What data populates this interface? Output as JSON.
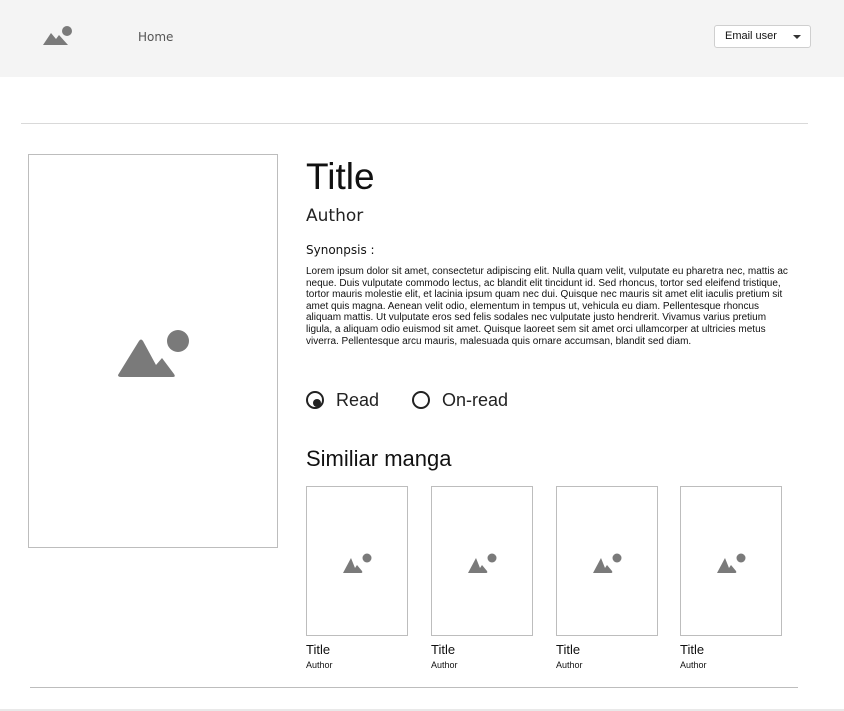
{
  "header": {
    "logo_icon": "image-placeholder-icon",
    "nav_home": "Home",
    "user_menu_label": "Email user"
  },
  "manga": {
    "cover_icon": "image-placeholder-icon",
    "title": "Title",
    "author": "Author",
    "synopsis_label": "Synonpsis :",
    "synopsis": "Lorem ipsum dolor sit amet, consectetur adipiscing elit. Nulla quam velit, vulputate eu pharetra nec, mattis ac neque. Duis vulputate commodo lectus, ac blandit elit tincidunt id. Sed rhoncus, tortor sed eleifend tristique, tortor mauris molestie elit, et lacinia ipsum quam nec dui. Quisque nec mauris sit amet elit iaculis pretium sit amet quis magna. Aenean velit odio, elementum in tempus ut, vehicula eu diam. Pellentesque rhoncus aliquam mattis. Ut vulputate eros sed felis sodales nec vulputate justo hendrerit. Vivamus varius pretium ligula, a aliquam odio euismod sit amet. Quisque laoreet sem sit amet orci ullamcorper at ultricies metus viverra. Pellentesque arcu mauris, malesuada quis ornare accumsan, blandit sed diam.",
    "status_options": [
      {
        "label": "Read",
        "selected": true
      },
      {
        "label": "On-read",
        "selected": false
      }
    ]
  },
  "similar": {
    "heading": "Similiar manga",
    "items": [
      {
        "title": "Title",
        "author": "Author"
      },
      {
        "title": "Title",
        "author": "Author"
      },
      {
        "title": "Title",
        "author": "Author"
      },
      {
        "title": "Title",
        "author": "Author"
      }
    ]
  },
  "colors": {
    "header_bg": "#f4f4f4",
    "placeholder_gray": "#7a7a7a",
    "border": "#bdbdbd"
  }
}
